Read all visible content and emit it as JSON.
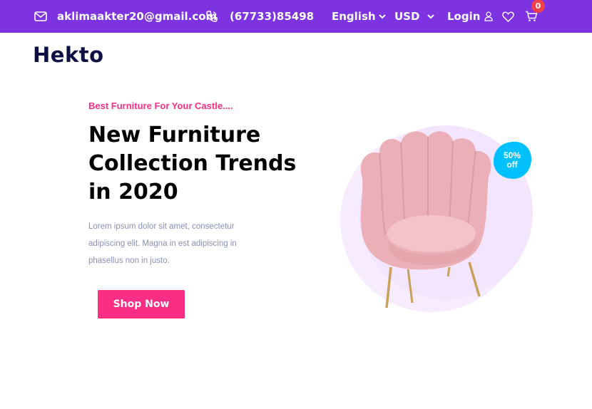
{
  "topbar": {
    "email": "aklimaakter20@gmail.com",
    "phone": "(67733)85498",
    "language": "English",
    "currency": "USD",
    "login": "Login",
    "cart_count": "0"
  },
  "brand": {
    "logo": "Hekto"
  },
  "hero": {
    "tagline": "Best Furniture For Your Castle....",
    "headline": "New Furniture Collection Trends in 2020",
    "description": "Lorem ipsum dolor sit amet, consectetur adipiscing elit. Magna in est adipiscing in phasellus non in justo.",
    "button_label": "Shop Now",
    "discount_line1": "50%",
    "discount_line2": "off"
  },
  "icons": {
    "mail": "mail-icon",
    "phone": "phone-icon",
    "chevron": "chevron-down-icon",
    "user": "user-icon",
    "heart": "heart-icon",
    "cart": "cart-icon"
  },
  "colors": {
    "topbar": "#7e33e0",
    "accent_pink": "#fb2e86",
    "navy": "#0d0e43",
    "badge": "#00c1fe",
    "cart_badge": "#f0404b"
  }
}
